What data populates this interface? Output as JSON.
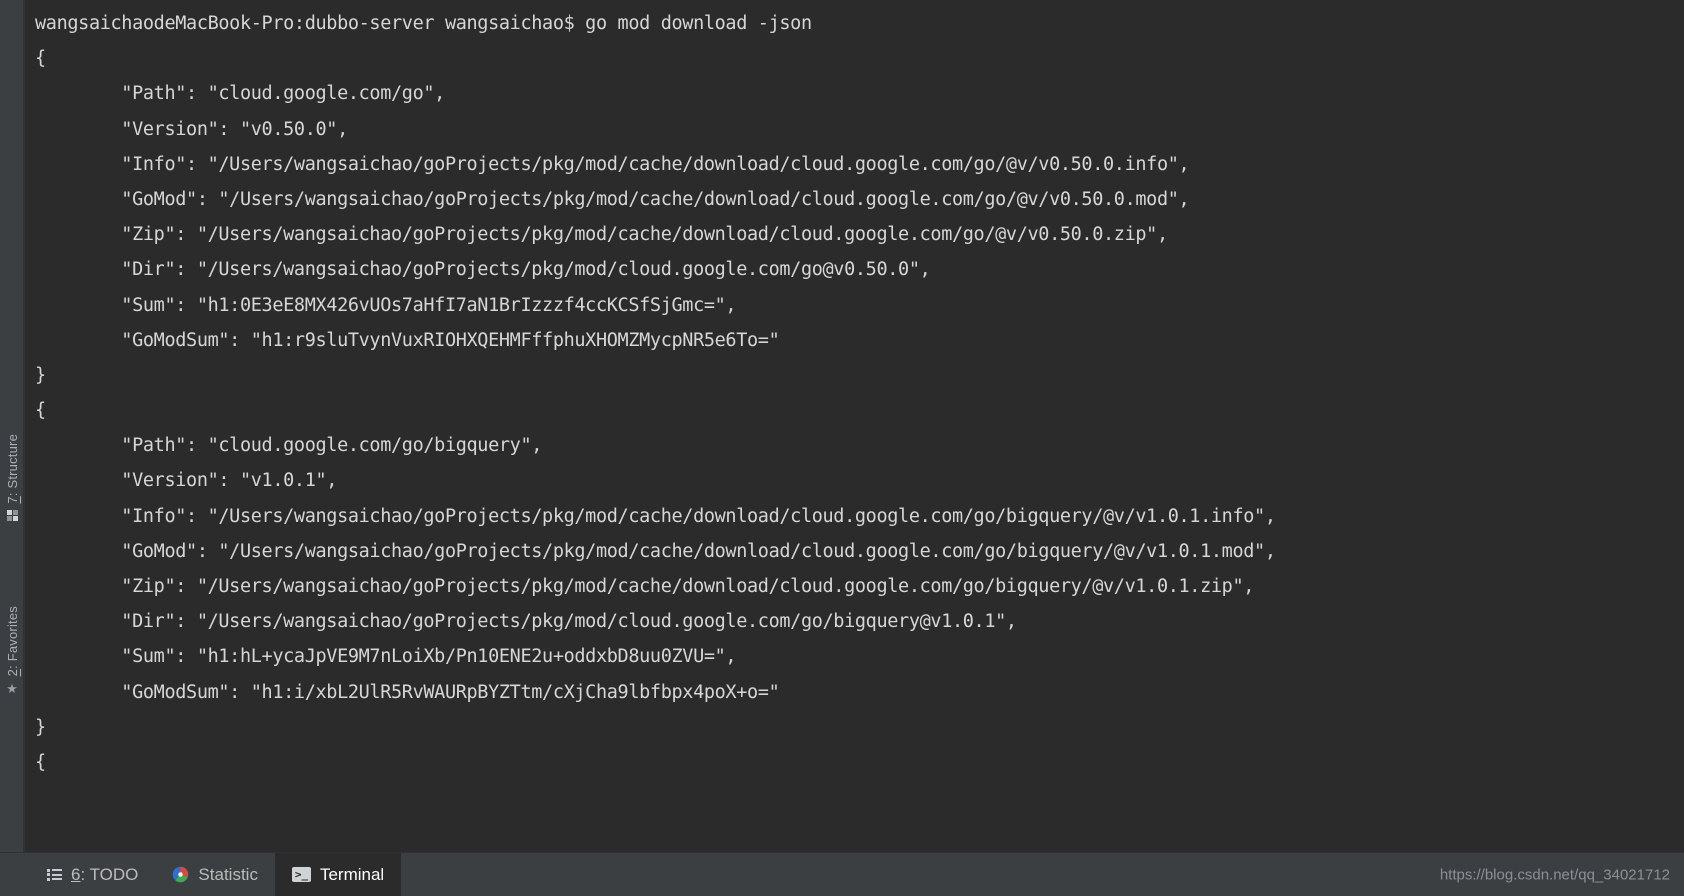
{
  "window": {
    "background": "#2b2b2b",
    "chrome_background": "#3c3f41",
    "text_color": "#d6d6d6",
    "accent": "#ffffff"
  },
  "left_toolbar": {
    "items": [
      {
        "id": "structure",
        "number": "7",
        "label": ": Structure",
        "icon": "grid-icon"
      },
      {
        "id": "favorites",
        "number": "2",
        "label": ": Favorites",
        "icon": "star-icon"
      }
    ]
  },
  "terminal": {
    "prompt": "wangsaichaodeMacBook-Pro:dubbo-server wangsaichao$ go mod download -json",
    "lines": [
      "wangsaichaodeMacBook-Pro:dubbo-server wangsaichao$ go mod download -json",
      "{",
      "        \"Path\": \"cloud.google.com/go\",",
      "        \"Version\": \"v0.50.0\",",
      "        \"Info\": \"/Users/wangsaichao/goProjects/pkg/mod/cache/download/cloud.google.com/go/@v/v0.50.0.info\",",
      "        \"GoMod\": \"/Users/wangsaichao/goProjects/pkg/mod/cache/download/cloud.google.com/go/@v/v0.50.0.mod\",",
      "        \"Zip\": \"/Users/wangsaichao/goProjects/pkg/mod/cache/download/cloud.google.com/go/@v/v0.50.0.zip\",",
      "        \"Dir\": \"/Users/wangsaichao/goProjects/pkg/mod/cloud.google.com/go@v0.50.0\",",
      "        \"Sum\": \"h1:0E3eE8MX426vUOs7aHfI7aN1BrIzzzf4ccKCSfSjGmc=\",",
      "        \"GoModSum\": \"h1:r9sluTvynVuxRIOHXQEHMFffphuXHOMZMycpNR5e6To=\"",
      "}",
      "{",
      "        \"Path\": \"cloud.google.com/go/bigquery\",",
      "        \"Version\": \"v1.0.1\",",
      "        \"Info\": \"/Users/wangsaichao/goProjects/pkg/mod/cache/download/cloud.google.com/go/bigquery/@v/v1.0.1.info\",",
      "        \"GoMod\": \"/Users/wangsaichao/goProjects/pkg/mod/cache/download/cloud.google.com/go/bigquery/@v/v1.0.1.mod\",",
      "        \"Zip\": \"/Users/wangsaichao/goProjects/pkg/mod/cache/download/cloud.google.com/go/bigquery/@v/v1.0.1.zip\",",
      "        \"Dir\": \"/Users/wangsaichao/goProjects/pkg/mod/cloud.google.com/go/bigquery@v1.0.1\",",
      "        \"Sum\": \"h1:hL+ycaJpVE9M7nLoiXb/Pn10ENE2u+oddxbD8uu0ZVU=\",",
      "        \"GoModSum\": \"h1:i/xbL2UlR5RvWAURpBYZTtm/cXjCha9lbfbpx4poX+o=\"",
      "}",
      "{"
    ]
  },
  "statusbar": {
    "tabs": [
      {
        "id": "todo",
        "number": "6",
        "label": ": TODO",
        "icon": "list-icon",
        "active": false
      },
      {
        "id": "statistic",
        "number": "",
        "label": "Statistic",
        "icon": "statistic-icon",
        "active": false
      },
      {
        "id": "terminal",
        "number": "",
        "label": "Terminal",
        "icon": "terminal-icon",
        "active": true
      }
    ],
    "watermark": "https://blog.csdn.net/qq_34021712"
  }
}
